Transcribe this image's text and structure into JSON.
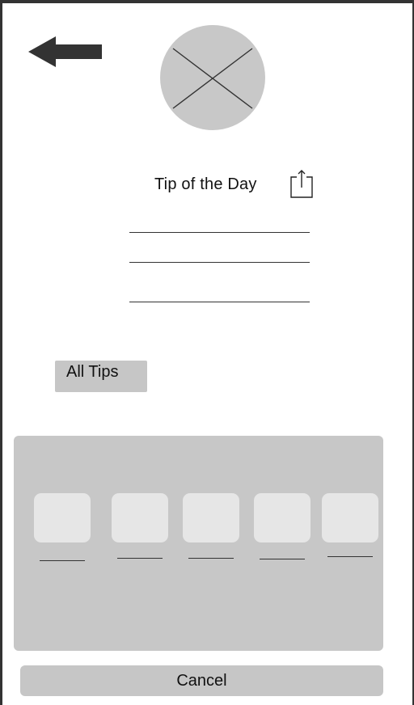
{
  "header": {
    "back_icon": "arrow-left-icon",
    "avatar_icon": "image-placeholder-icon"
  },
  "tip": {
    "title": "Tip of the Day",
    "share_icon": "share-icon",
    "placeholder_lines": 3
  },
  "all_tips_label": "All Tips",
  "share_sheet": {
    "app_count": 5,
    "app_icon": "app-placeholder-icon"
  },
  "cancel_label": "Cancel",
  "colors": {
    "frame": "#333333",
    "panel": "#c7c7c7",
    "tile": "#e6e6e6",
    "avatar": "#c8c8c8",
    "background": "#ffffff"
  }
}
